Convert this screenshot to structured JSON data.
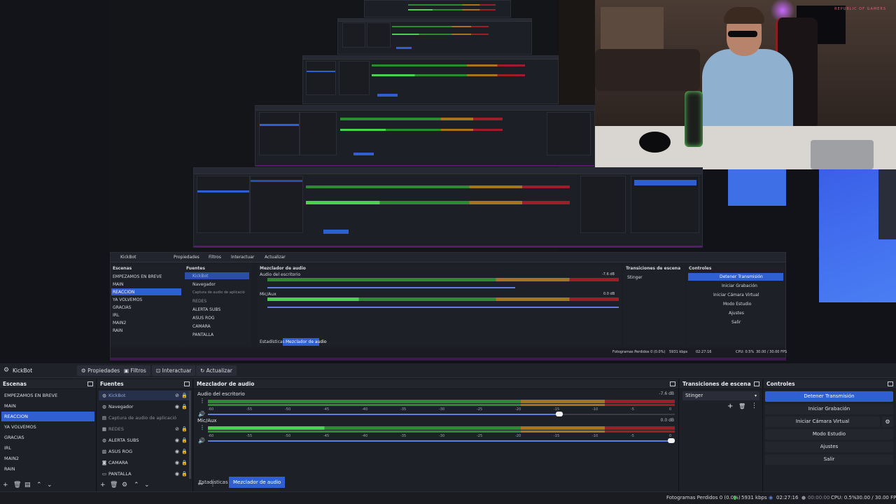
{
  "watermark": "REPUBLIC OF GAMERS",
  "preview_window": {
    "title": "KickBot",
    "toolbar": [
      "Propiedades",
      "Filtros",
      "Interactuar",
      "Actualizar"
    ],
    "scenes_title": "Escenas",
    "scenes": [
      "EMPEZAMOS EN BREVE",
      "MAIN",
      "REACCION",
      "YA VOLVEMOS",
      "GRACIAS",
      "IRL",
      "MAIN2",
      "RAIN"
    ],
    "sources_title": "Fuentes",
    "sources": [
      "KickBot",
      "Navegador",
      "Captura de audio de aplicació",
      "REDES",
      "ALERTA SUBS",
      "ASUS ROG",
      "CAMARA",
      "PANTALLA"
    ],
    "mixer_title": "Mezclador de audio",
    "desktop_audio": "Audio del escritorio",
    "mic": "Mic/Aux",
    "desktop_db": "-7.6 dB",
    "mic_db": "0.0 dB",
    "transitions_title": "Transiciones de escena",
    "transition": "Stinger",
    "controls_title": "Controles",
    "controls": [
      "Detener Transmisión",
      "Iniciar Grabación",
      "Iniciar Cámara Virtual",
      "Modo Estudio",
      "Ajustes",
      "Salir"
    ],
    "tabs": [
      "Estadísticas",
      "Mezclador de audio"
    ],
    "status": [
      "Fotogramas Perdidos 0 (0.0%)",
      "5931 kbps",
      "02:27:16",
      "CPU: 0.5%",
      "30.00 / 30.00 FPS"
    ]
  },
  "obs": {
    "title": "KickBot",
    "toolbar": {
      "properties": "Propiedades",
      "filters": "Filtros",
      "interact": "Interactuar",
      "refresh": "Actualizar"
    },
    "scenes": {
      "title": "Escenas",
      "items": [
        "EMPEZAMOS EN BREVE",
        "MAIN",
        "REACCION",
        "YA VOLVEMOS",
        "GRACIAS",
        "IRL",
        "MAIN2",
        "RAIN"
      ],
      "selected_index": 2
    },
    "sources": {
      "title": "Fuentes",
      "items": [
        "KickBot",
        "Navegador",
        "Captura de audio de aplicació",
        "REDES",
        "ALERTA SUBS",
        "ASUS ROG",
        "CAMARA",
        "PANTALLA"
      ]
    },
    "mixer": {
      "title": "Mezclador de audio",
      "channels": [
        {
          "name": "Audio del escritorio",
          "db": "-7.6 dB",
          "level": 0.26,
          "volume": 0.76
        },
        {
          "name": "Mic/Aux",
          "db": "0.0 dB",
          "level": 0.25,
          "volume": 1.0
        }
      ],
      "ticks": [
        "-60",
        "-55",
        "-50",
        "-45",
        "-40",
        "-35",
        "-30",
        "-25",
        "-20",
        "-15",
        "-10",
        "-5",
        "0"
      ]
    },
    "transitions": {
      "title": "Transiciones de escena",
      "selected": "Stinger"
    },
    "controls": {
      "title": "Controles",
      "stop_stream": "Detener Transmisión",
      "start_recording": "Iniciar Grabación",
      "start_virtual_cam": "Iniciar Cámara Virtual",
      "studio_mode": "Modo Estudio",
      "settings": "Ajustes",
      "exit": "Salir"
    },
    "tabs": {
      "stats": "Estadísticas",
      "mixer": "Mezclador de audio"
    },
    "status": {
      "dropped": "Fotogramas Perdidos 0 (0.0%)",
      "bitrate": "5931 kbps",
      "live_time": "02:27:16",
      "rec_time": "00:00:00",
      "cpu": "CPU: 0.5%",
      "fps": "30.00 / 30.00 FPS"
    }
  },
  "colors": {
    "accent": "#2f5fd0",
    "meter_green": "#49d14f",
    "meter_yellow": "#a7741d",
    "meter_red": "#9b1e2a",
    "purple_edge": "#5b1d6f"
  }
}
